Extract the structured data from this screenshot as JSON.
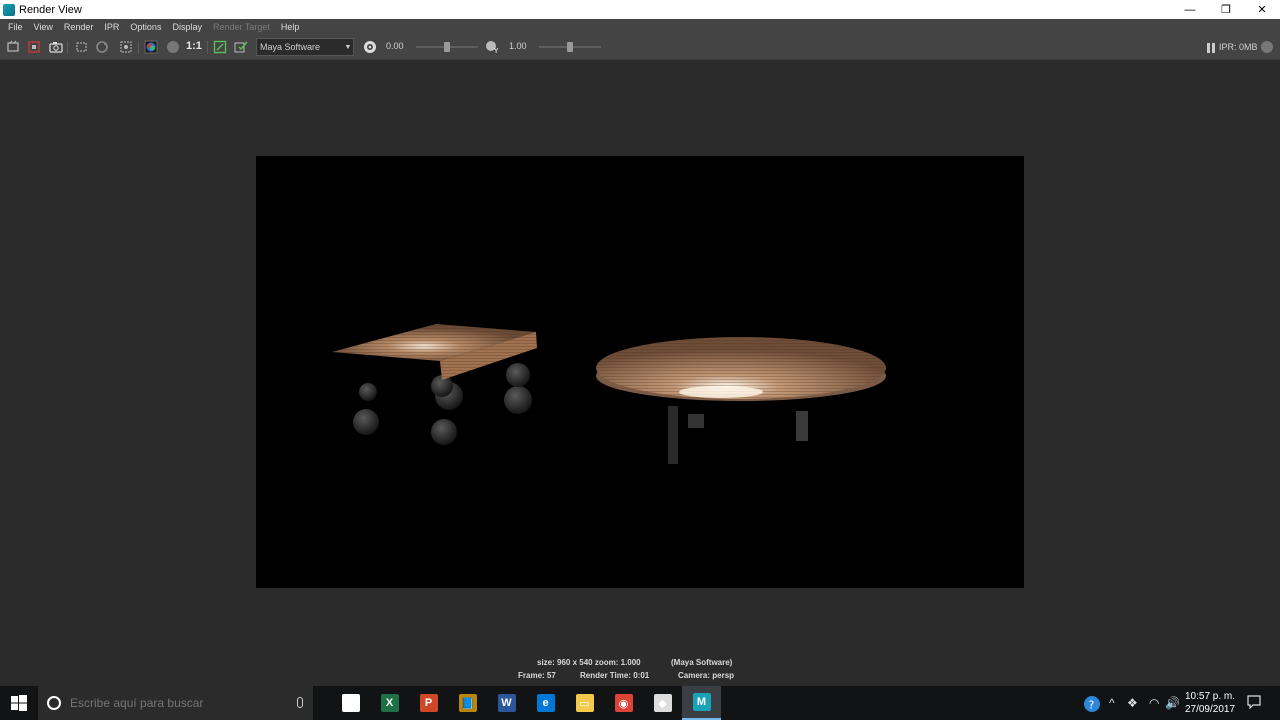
{
  "window": {
    "title": "Render View",
    "controls": {
      "minimize": "—",
      "restore": "❐",
      "close": "✕"
    }
  },
  "menu": [
    "File",
    "View",
    "Render",
    "IPR",
    "Options",
    "Display",
    "Render Target",
    "Help"
  ],
  "menu_disabled": "Render Target",
  "toolbar": {
    "ratio_label": "1:1",
    "renderer": "Maya Software",
    "exposure_value": "0.00",
    "exposure_level": 0.5,
    "gamma_value": "1.00",
    "gamma_level": 0.5,
    "ipr_status": "IPR: 0MB"
  },
  "status": {
    "size_zoom": "size: 960 x 540 zoom: 1.000",
    "renderer": "(Maya Software)",
    "frame": "Frame: 57",
    "render_time": "Render Time: 0:01",
    "camera": "Camera: persp"
  },
  "taskbar": {
    "search_placeholder": "Escribe aquí para buscar",
    "apps": [
      {
        "name": "store-app",
        "glyph": "🛍",
        "color": "#ffffff"
      },
      {
        "name": "excel-app",
        "glyph": "X",
        "color": "#1e7145"
      },
      {
        "name": "powerpoint-app",
        "glyph": "P",
        "color": "#d24726"
      },
      {
        "name": "files-app",
        "glyph": "📘",
        "color": "#b8860b"
      },
      {
        "name": "word-app",
        "glyph": "W",
        "color": "#2b579a"
      },
      {
        "name": "edge-app",
        "glyph": "e",
        "color": "#0078d7"
      },
      {
        "name": "explorer-app",
        "glyph": "▭",
        "color": "#f2c94c"
      },
      {
        "name": "chrome-app",
        "glyph": "◉",
        "color": "#db4437"
      },
      {
        "name": "unity-app",
        "glyph": "◆",
        "color": "#dddddd"
      },
      {
        "name": "maya-app",
        "glyph": "M",
        "color": "#1aa3b8"
      }
    ],
    "clock_time": "10:57 p. m.",
    "clock_date": "27/09/2017"
  },
  "colors": {
    "background": "#2b2b2b",
    "toolbar": "#444444",
    "accent": "#76b9ed"
  }
}
